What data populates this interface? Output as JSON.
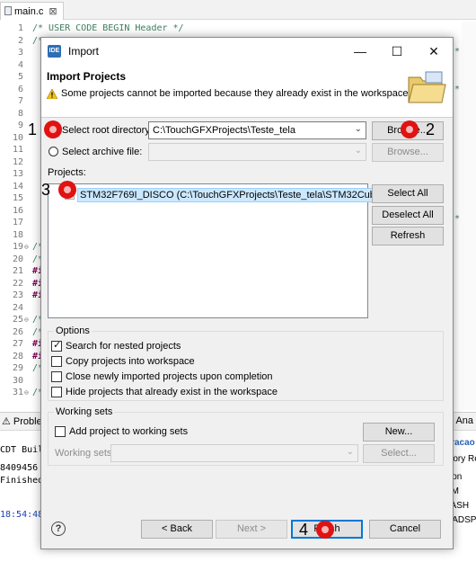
{
  "ide": {
    "editor_tab": "main.c",
    "editor_tab_close": "⊠",
    "code_top_comment": "/* USER CODE BEGIN Header */",
    "line_numbers": [
      "1",
      "2",
      "3",
      "4",
      "5",
      "6",
      "7",
      "8",
      "9",
      "10",
      "11",
      "12",
      "13",
      "14",
      "15",
      "16",
      "17",
      "18",
      "19",
      "20",
      "21",
      "22",
      "23",
      "24",
      "25",
      "26",
      "27",
      "28",
      "29",
      "30",
      "31"
    ],
    "visible_code_fragments": [
      {
        "line": 2,
        "text": "/*"
      },
      {
        "line": 19,
        "text": "/*"
      },
      {
        "line": 20,
        "text": "/*"
      },
      {
        "line": 21,
        "text": "#i"
      },
      {
        "line": 22,
        "text": "#i"
      },
      {
        "line": 23,
        "text": "#i"
      },
      {
        "line": 25,
        "text": "/*"
      },
      {
        "line": 26,
        "text": "/*"
      },
      {
        "line": 27,
        "text": "#i"
      },
      {
        "line": 28,
        "text": "#i"
      },
      {
        "line": 29,
        "text": "/*"
      },
      {
        "line": 31,
        "text": "/*"
      }
    ],
    "right_edge_stars": "**",
    "bottom_panel": {
      "tab_problems": "Proble",
      "tab_right": "ild Ana",
      "console_title": "CDT Build C",
      "console_lines": [
        "8409456",
        "Finished",
        "18:54:48"
      ],
      "right_fragments": [
        "gracao",
        "mory Re",
        "sion",
        "AM",
        "LASH",
        "UADSP"
      ]
    }
  },
  "dialog": {
    "title": "Import",
    "app_icon_text": "IDE",
    "window_buttons": {
      "minimize": "—",
      "maximize": "☐",
      "close": "✕"
    },
    "header": {
      "title": "Import Projects",
      "message": "Some projects cannot be imported because they already exist in the workspace"
    },
    "root_directory": {
      "label": "Select root directory:",
      "value": "C:\\TouchGFXProjects\\Teste_tela",
      "selected": true,
      "browse": "Browse..."
    },
    "archive_file": {
      "label": "Select archive file:",
      "value": "",
      "selected": false,
      "browse": "Browse..."
    },
    "projects_label": "Projects:",
    "projects": [
      {
        "name": "STM32F769I_DISCO (C:\\TouchGFXProjects\\Teste_tela\\STM32CubeIDE)",
        "checked": false
      }
    ],
    "list_buttons": {
      "select_all": "Select All",
      "deselect_all": "Deselect All",
      "refresh": "Refresh"
    },
    "options": {
      "title": "Options",
      "items": [
        {
          "label": "Search for nested projects",
          "checked": true
        },
        {
          "label": "Copy projects into workspace",
          "checked": false
        },
        {
          "label": "Close newly imported projects upon completion",
          "checked": false
        },
        {
          "label": "Hide projects that already exist in the workspace",
          "checked": false
        }
      ]
    },
    "working_sets": {
      "title": "Working sets",
      "add_label": "Add project to working sets",
      "add_checked": false,
      "new_button": "New...",
      "sets_label": "Working sets:",
      "sets_value": "",
      "select_button": "Select..."
    },
    "footer": {
      "help": "?",
      "back": "< Back",
      "next": "Next >",
      "finish": "Finish",
      "cancel": "Cancel"
    }
  },
  "annotations": {
    "step1": "1",
    "step2": "2",
    "step3": "3",
    "step4": "4",
    "marker_color": "#e01212"
  },
  "colors": {
    "selection": "#cce8ff",
    "dialog_bg": "#f0f0f0",
    "primary_border": "#0078d7",
    "comment_green": "#3f7f5f"
  }
}
